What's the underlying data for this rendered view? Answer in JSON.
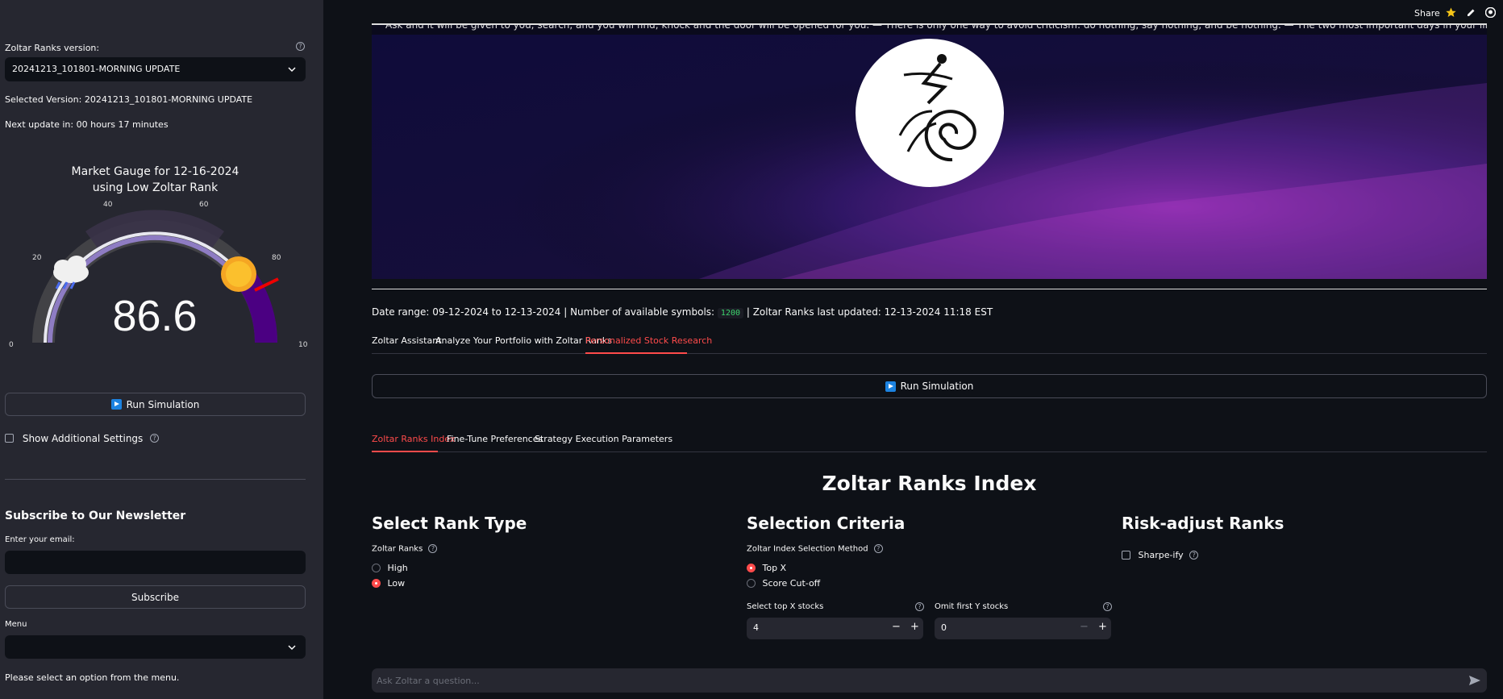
{
  "topbar": {
    "share": "Share"
  },
  "sidebar": {
    "version_label": "Zoltar Ranks version:",
    "version_value": "20241213_101801-MORNING UPDATE",
    "selected_version": "Selected Version: 20241213_101801-MORNING UPDATE",
    "next_update": "Next update in: 00 hours 17 minutes",
    "gauge": {
      "title_line1": "Market Gauge for 12-16-2024",
      "title_line2": "using Low Zoltar Rank",
      "value": "86.6",
      "ticks": [
        "0",
        "20",
        "40",
        "60",
        "80",
        "10"
      ]
    },
    "run_simulation": "Run Simulation",
    "show_additional": "Show Additional Settings",
    "newsletter_title": "Subscribe to Our Newsletter",
    "email_label": "Enter your email:",
    "subscribe": "Subscribe",
    "menu_label": "Menu",
    "menu_hint": "Please select an option from the menu."
  },
  "main": {
    "marquee": "Ask and it will be given to you; search, and you will find; knock and the door will be opened for you.   —   There is only one way to avoid criticism: do nothing, say nothing, and be nothing.   —   The two most important days in your life",
    "date_range_prefix": "Date range: 09-12-2024 to 12-13-2024 | Number of available symbols:",
    "symbols_count": "1200",
    "date_range_suffix": "| Zoltar Ranks last updated: 12-13-2024 11:18 EST",
    "tabs": [
      "Zoltar Assistant",
      "Analyze Your Portfolio with Zoltar Ranks",
      "Personalized Stock Research"
    ],
    "run_simulation": "Run Simulation",
    "subtabs": [
      "Zoltar Ranks Index",
      "Fine-Tune Preferences",
      "Strategy Execution Parameters"
    ],
    "section_title": "Zoltar Ranks Index",
    "col1": {
      "title": "Select Rank Type",
      "label": "Zoltar Ranks",
      "options": [
        "High",
        "Low"
      ]
    },
    "col2": {
      "title": "Selection Criteria",
      "label": "Zoltar Index Selection Method",
      "options": [
        "Top X",
        "Score Cut-off"
      ],
      "topx_label": "Select top X stocks",
      "topx_value": "4",
      "omit_label": "Omit first Y stocks",
      "omit_value": "0"
    },
    "col3": {
      "title": "Risk-adjust Ranks",
      "sharpe": "Sharpe-ify"
    },
    "chat_placeholder": "Ask Zoltar a question..."
  },
  "colors": {
    "accent": "#ff4b4b",
    "sidebar_bg": "#262730",
    "main_bg": "#0e1117",
    "gauge_fill": "#4b0082"
  }
}
